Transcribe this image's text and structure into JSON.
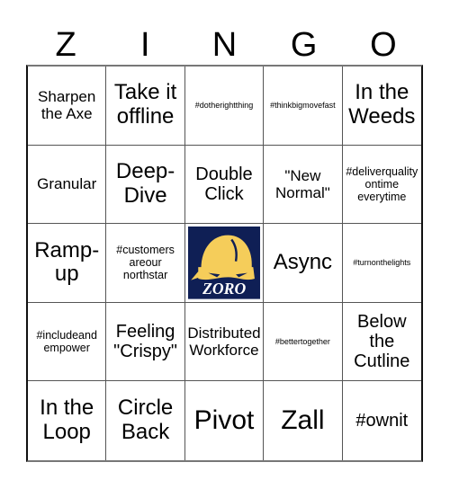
{
  "header": {
    "letters": [
      "Z",
      "I",
      "N",
      "G",
      "O"
    ]
  },
  "colors": {
    "logo_bg": "#0f1f55",
    "logo_helmet": "#f5cd5a",
    "logo_text": "#ffffff"
  },
  "grid": {
    "cells": [
      {
        "text": "Sharpen the Axe",
        "size": "s-md"
      },
      {
        "text": "Take it offline",
        "size": "s-xl"
      },
      {
        "text": "#dotherightthing",
        "size": "s-xs"
      },
      {
        "text": "#thinkbigmovefast",
        "size": "s-xs"
      },
      {
        "text": "In the Weeds",
        "size": "s-xl"
      },
      {
        "text": "Granular",
        "size": "s-md"
      },
      {
        "text": "Deep-Dive",
        "size": "s-xl"
      },
      {
        "text": "Double Click",
        "size": "s-lg"
      },
      {
        "text": "\"New Normal\"",
        "size": "s-md"
      },
      {
        "text": "#deliverquality ontime everytime",
        "size": "s-sm"
      },
      {
        "text": "Ramp-up",
        "size": "s-xl"
      },
      {
        "text": "#customers areour northstar",
        "size": "s-sm"
      },
      {
        "text": "ZORO",
        "free": true
      },
      {
        "text": "Async",
        "size": "s-xl"
      },
      {
        "text": "#turnonthelights",
        "size": "s-xs"
      },
      {
        "text": "#includeand empower",
        "size": "s-sm"
      },
      {
        "text": "Feeling \"Crispy\"",
        "size": "s-lg"
      },
      {
        "text": "Distributed Workforce",
        "size": "s-md"
      },
      {
        "text": "#bettertogether",
        "size": "s-xs"
      },
      {
        "text": "Below the Cutline",
        "size": "s-lg"
      },
      {
        "text": "In the Loop",
        "size": "s-xl"
      },
      {
        "text": "Circle Back",
        "size": "s-xl"
      },
      {
        "text": "Pivot",
        "size": "s-xxl"
      },
      {
        "text": "Zall",
        "size": "s-xxl"
      },
      {
        "text": "#ownit",
        "size": "s-lg"
      }
    ]
  }
}
